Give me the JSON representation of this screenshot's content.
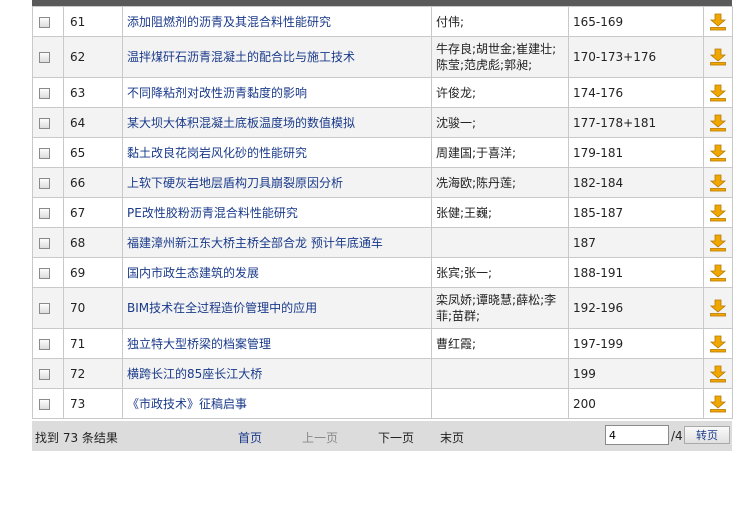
{
  "colors": {
    "link": "#1a3a8a",
    "download_icon": "#f0a800",
    "footer_bg": "#dcdcdc"
  },
  "icons": {
    "download": "download-arrow-icon",
    "checkbox": "checkbox"
  },
  "rows": [
    {
      "num": "61",
      "title": "添加阻燃剂的沥青及其混合料性能研究",
      "authors": "付伟;",
      "pages": "165-169"
    },
    {
      "num": "62",
      "title": "温拌煤矸石沥青混凝土的配合比与施工技术",
      "authors": "牛存良;胡世金;崔建壮;陈莹;范虎彪;郭昶;",
      "pages": "170-173+176"
    },
    {
      "num": "63",
      "title": "不同降粘剂对改性沥青黏度的影响",
      "authors": "许俊龙;",
      "pages": "174-176"
    },
    {
      "num": "64",
      "title": "某大坝大体积混凝土底板温度场的数值模拟",
      "authors": "沈骏一;",
      "pages": "177-178+181"
    },
    {
      "num": "65",
      "title": "黏土改良花岗岩风化砂的性能研究",
      "authors": "周建国;于喜洋;",
      "pages": "179-181"
    },
    {
      "num": "66",
      "title": "上软下硬灰岩地层盾构刀具崩裂原因分析",
      "authors": "冼海欧;陈丹莲;",
      "pages": "182-184"
    },
    {
      "num": "67",
      "title": "PE改性胶粉沥青混合料性能研究",
      "authors": "张健;王巍;",
      "pages": "185-187"
    },
    {
      "num": "68",
      "title": "福建漳州新江东大桥主桥全部合龙  预计年底通车",
      "authors": "",
      "pages": "187"
    },
    {
      "num": "69",
      "title": "国内市政生态建筑的发展",
      "authors": "张宾;张一;",
      "pages": "188-191"
    },
    {
      "num": "70",
      "title": "BIM技术在全过程造价管理中的应用",
      "authors": "栾凤娇;谭晓慧;薛松;李菲;苗群;",
      "pages": "192-196"
    },
    {
      "num": "71",
      "title": "独立特大型桥梁的档案管理",
      "authors": "曹红霞;",
      "pages": "197-199"
    },
    {
      "num": "72",
      "title": "横跨长江的85座长江大桥",
      "authors": "",
      "pages": "199"
    },
    {
      "num": "73",
      "title": "《市政技术》征稿启事",
      "authors": "",
      "pages": "200"
    }
  ],
  "footer": {
    "result_count": "找到 73 条结果",
    "first": "首页",
    "prev": "上一页",
    "next": "下一页",
    "last": "末页",
    "page_input_value": "4",
    "total_pages": "/4",
    "go": "转页"
  }
}
